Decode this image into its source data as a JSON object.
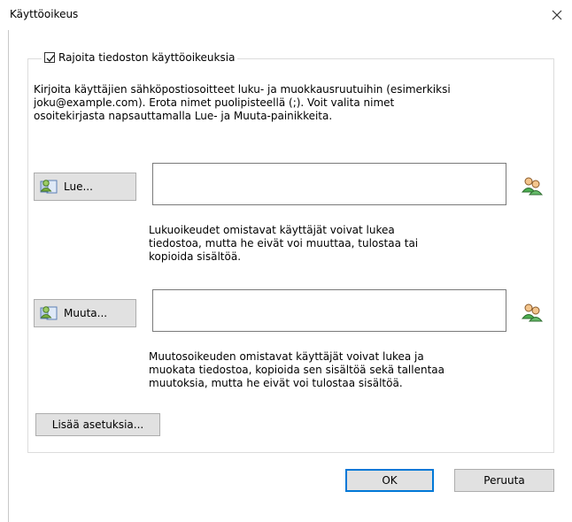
{
  "window": {
    "title": "Käyttöoikeus"
  },
  "restrict": {
    "label": "Rajoita tiedoston käyttöoikeuksia",
    "checked": true
  },
  "description": "Kirjoita käyttäjien sähköpostiosoitteet luku- ja muokkausruutuihin (esimerkiksi\njoku@example.com). Erota nimet puolipisteellä (;). Voit valita nimet\nosoitekirjasta napsauttamalla Lue- ja Muuta-painikkeita.",
  "read": {
    "button_label": "Lue...",
    "field_value": "",
    "help": "Lukuoikeudet omistavat käyttäjät voivat lukea\ntiedostoa, mutta he eivät voi muuttaa, tulostaa tai\nkopioida sisältöä."
  },
  "change": {
    "button_label": "Muuta...",
    "field_value": "",
    "help": "Muutosoikeuden omistavat käyttäjät voivat lukea ja\nmuokata tiedostoa, kopioida sen sisältöä sekä tallentaa\nmuutoksia, mutta he eivät voi tulostaa sisältöä."
  },
  "more_options": "Lisää asetuksia...",
  "buttons": {
    "ok": "OK",
    "cancel": "Peruuta"
  }
}
